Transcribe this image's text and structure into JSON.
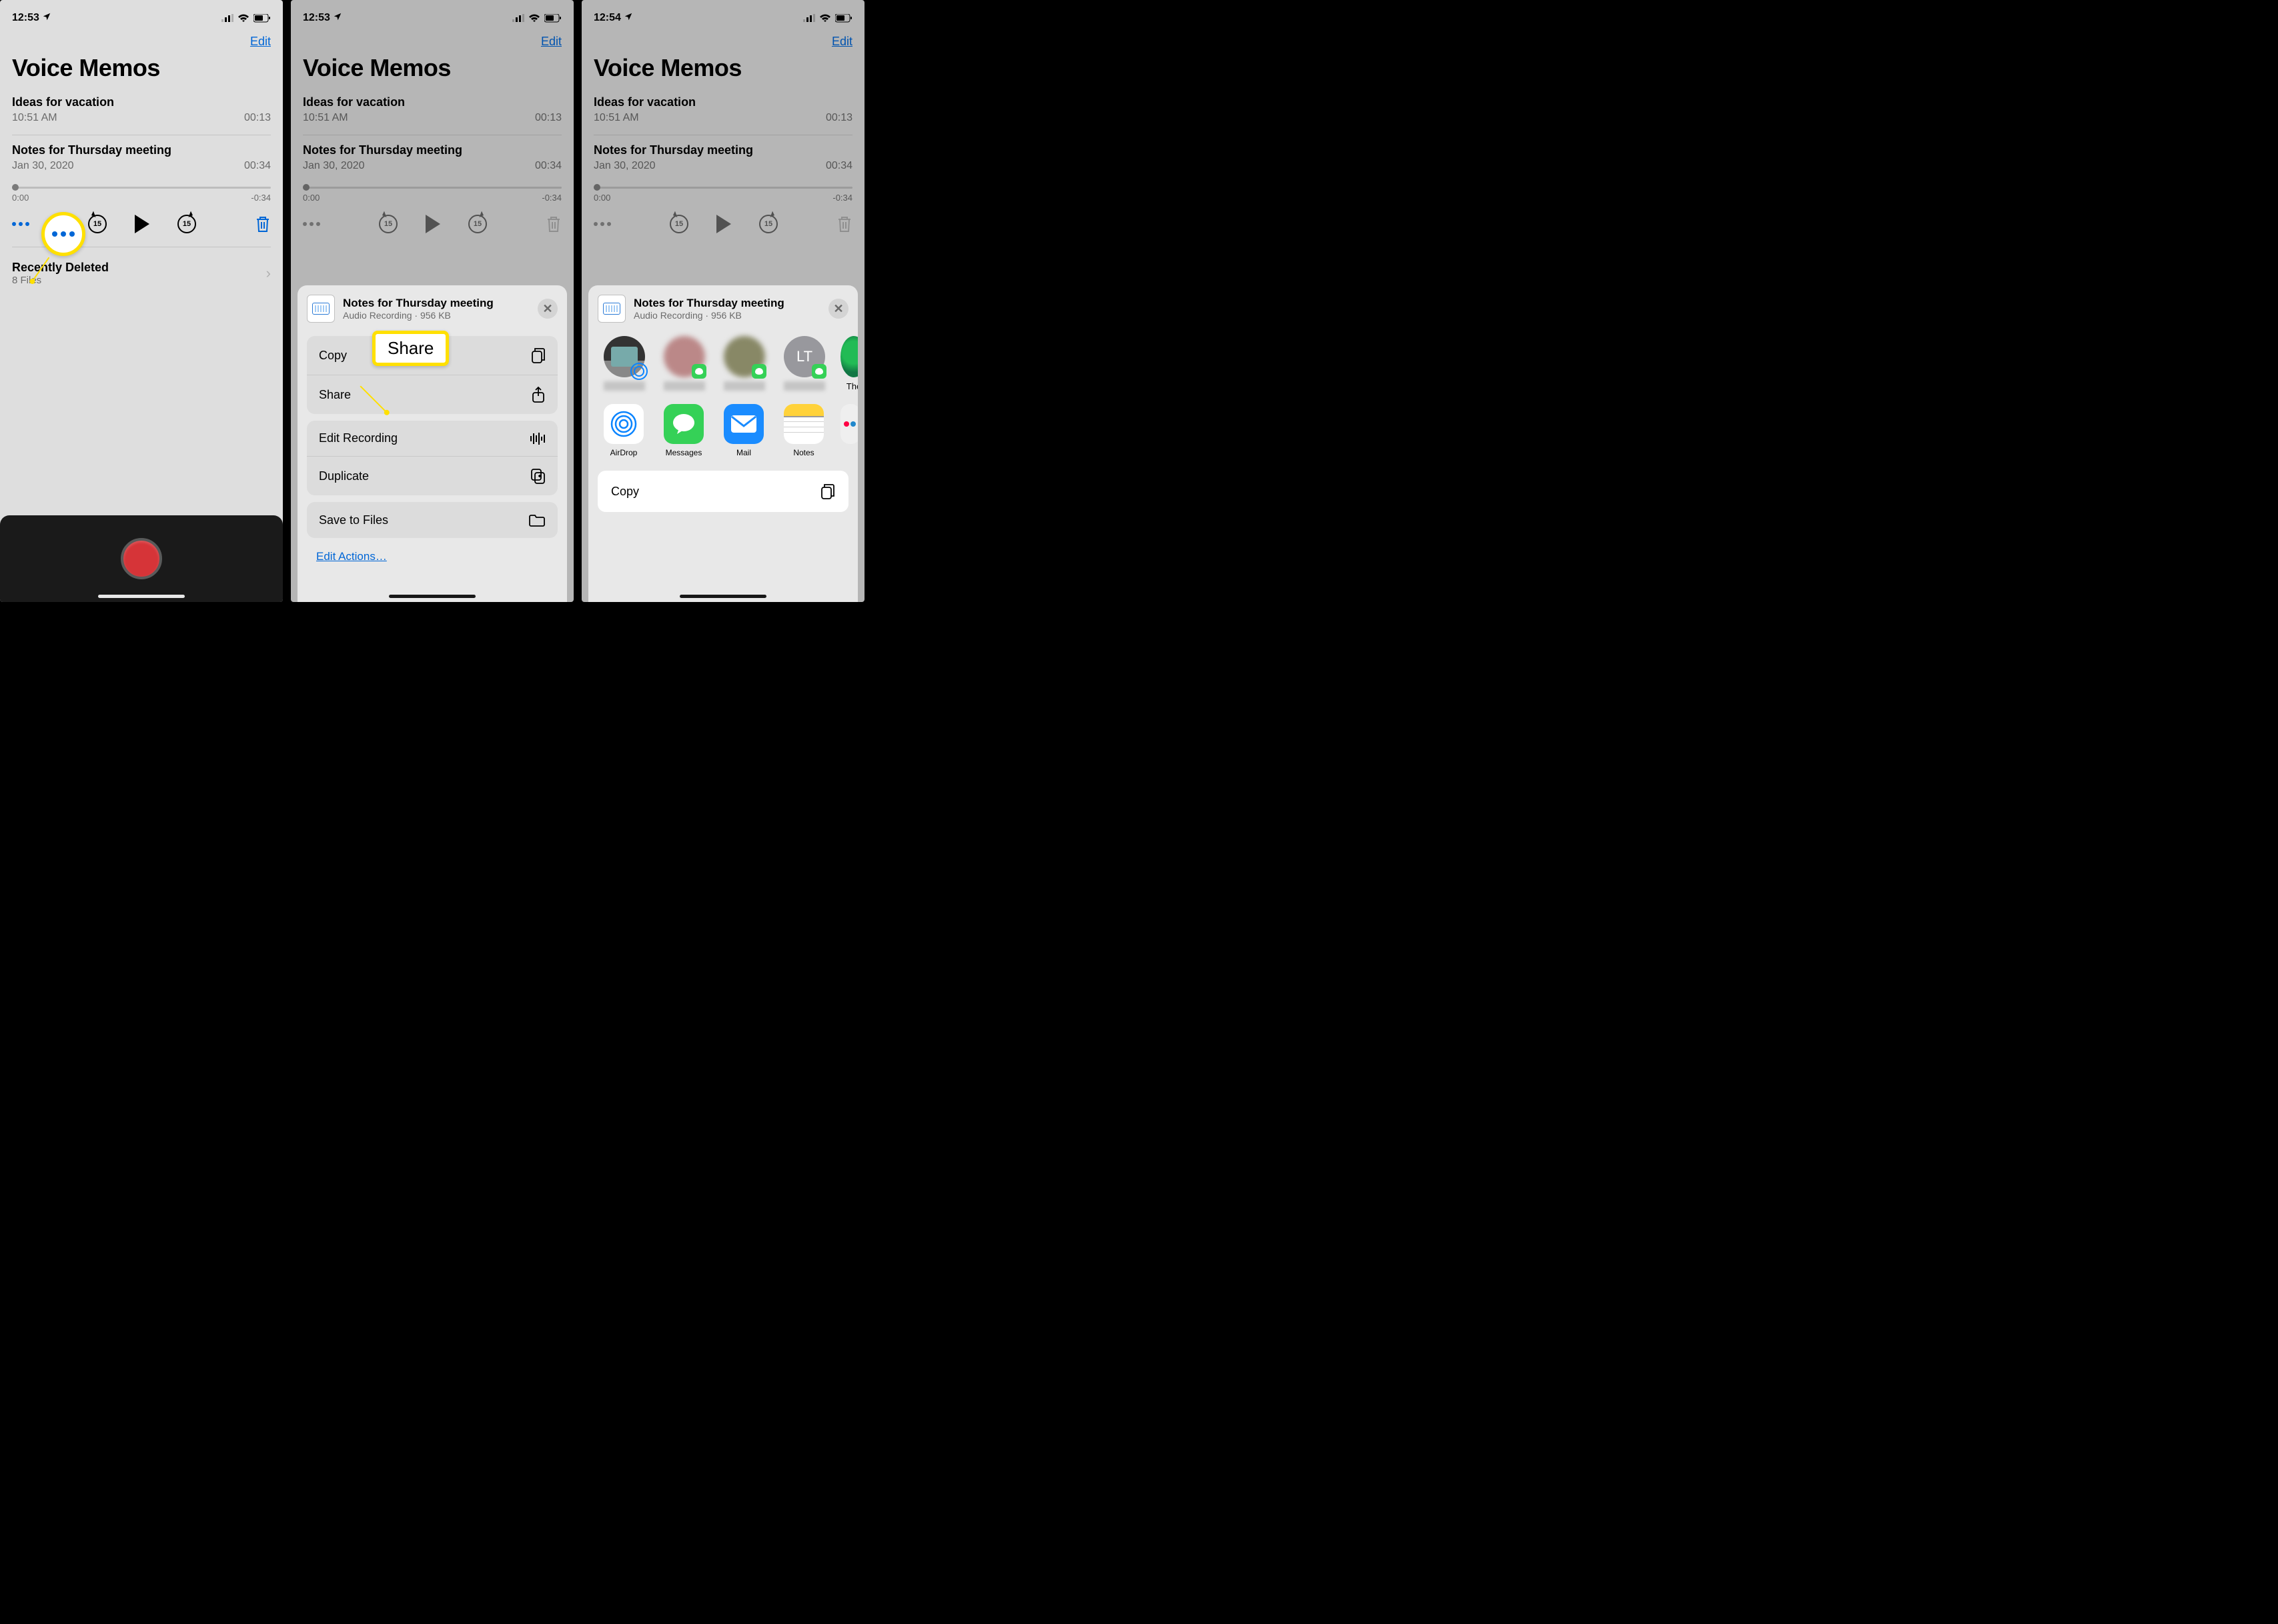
{
  "screens": {
    "s1": {
      "time": "12:53"
    },
    "s2": {
      "time": "12:53"
    },
    "s3": {
      "time": "12:54"
    }
  },
  "header": {
    "edit": "Edit",
    "title": "Voice Memos"
  },
  "memos": {
    "m1": {
      "title": "Ideas for vacation",
      "date": "10:51 AM",
      "duration": "00:13"
    },
    "m2": {
      "title": "Notes for Thursday meeting",
      "date": "Jan 30, 2020",
      "duration": "00:34"
    }
  },
  "scrub": {
    "start": "0:00",
    "remain": "-0:34"
  },
  "skip": {
    "val": "15"
  },
  "deleted": {
    "title": "Recently Deleted",
    "count": "8 Files"
  },
  "sheet": {
    "title": "Notes for Thursday meeting",
    "sub": "Audio Recording · 956 KB",
    "copy": "Copy",
    "share": "Share",
    "edit_recording": "Edit Recording",
    "duplicate": "Duplicate",
    "save_to_files": "Save to Files",
    "edit_actions": "Edit Actions…"
  },
  "callout": {
    "share_label": "Share"
  },
  "contacts": {
    "initials": "LT",
    "last_name": "The"
  },
  "apps": {
    "airdrop": "AirDrop",
    "messages": "Messages",
    "mail": "Mail",
    "notes": "Notes"
  },
  "actions": {
    "copy": "Copy"
  }
}
